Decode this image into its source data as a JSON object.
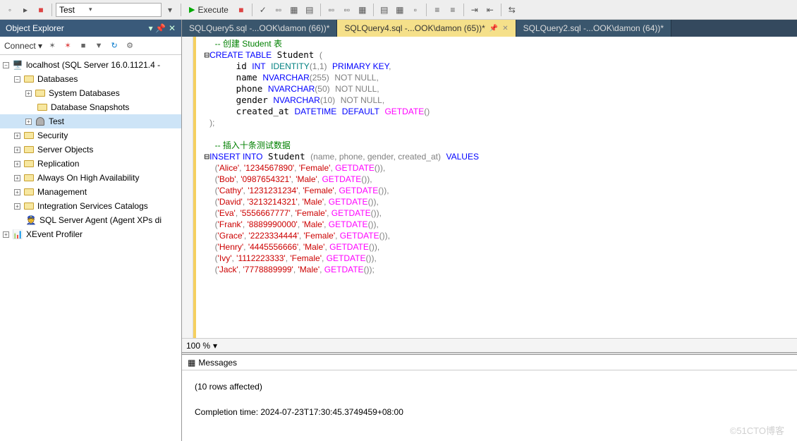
{
  "toolbar": {
    "db_combo": "Test",
    "execute_label": "Execute"
  },
  "sidebar": {
    "title": "Object Explorer",
    "connect_label": "Connect",
    "tree": {
      "server": "localhost (SQL Server 16.0.1121.4 -",
      "databases": "Databases",
      "sysdb": "System Databases",
      "snapshots": "Database Snapshots",
      "test": "Test",
      "security": "Security",
      "server_objects": "Server Objects",
      "replication": "Replication",
      "always_on": "Always On High Availability",
      "management": "Management",
      "isc": "Integration Services Catalogs",
      "agent": "SQL Server Agent (Agent XPs di",
      "xevent": "XEvent Profiler"
    }
  },
  "tabs": [
    {
      "label": "SQLQuery5.sql -...OOK\\damon (66))*"
    },
    {
      "label": "SQLQuery4.sql -...OOK\\damon (65))*"
    },
    {
      "label": "SQLQuery2.sql -...OOK\\damon (64))*"
    }
  ],
  "code": {
    "comment1": "-- 创建 Student 表",
    "create": "CREATE TABLE",
    "student": "Student",
    "lp": "(",
    "id_line": "    id",
    "int": "INT",
    "identity": "IDENTITY",
    "id_args": "(1,1)",
    "pk": "PRIMARY KEY",
    "comma": ",",
    "name_line": "    name",
    "nvarchar": "NVARCHAR",
    "n255": "(255)",
    "notnull": "NOT NULL",
    "phone_line": "    phone",
    "n50": "(50)",
    "gender_line": "    gender",
    "n10": "(10)",
    "created_line": "    created_at",
    "datetime": "DATETIME",
    "default": "DEFAULT",
    "getdate": "GETDATE",
    "paren": "()",
    "rp": ");",
    "comment2": "-- 插入十条测试数据",
    "insert": "INSERT INTO",
    "cols": "(name, phone, gender, created_at)",
    "values": "VALUES",
    "rows": [
      [
        "'Alice'",
        "'1234567890'",
        "'Female'"
      ],
      [
        "'Bob'",
        "'0987654321'",
        "'Male'"
      ],
      [
        "'Cathy'",
        "'1231231234'",
        "'Female'"
      ],
      [
        "'David'",
        "'3213214321'",
        "'Male'"
      ],
      [
        "'Eva'",
        "'5556667777'",
        "'Female'"
      ],
      [
        "'Frank'",
        "'8889990000'",
        "'Male'"
      ],
      [
        "'Grace'",
        "'2223334444'",
        "'Female'"
      ],
      [
        "'Henry'",
        "'4445556666'",
        "'Male'"
      ],
      [
        "'Ivy'",
        "'1112223333'",
        "'Female'"
      ],
      [
        "'Jack'",
        "'7778889999'",
        "'Male'"
      ]
    ]
  },
  "zoom": {
    "level": "100 %"
  },
  "messages": {
    "tab": "Messages",
    "rows_affected": "(10 rows affected)",
    "completion": "Completion time: 2024-07-23T17:30:45.3749459+08:00"
  },
  "watermark": "©51CTO博客"
}
